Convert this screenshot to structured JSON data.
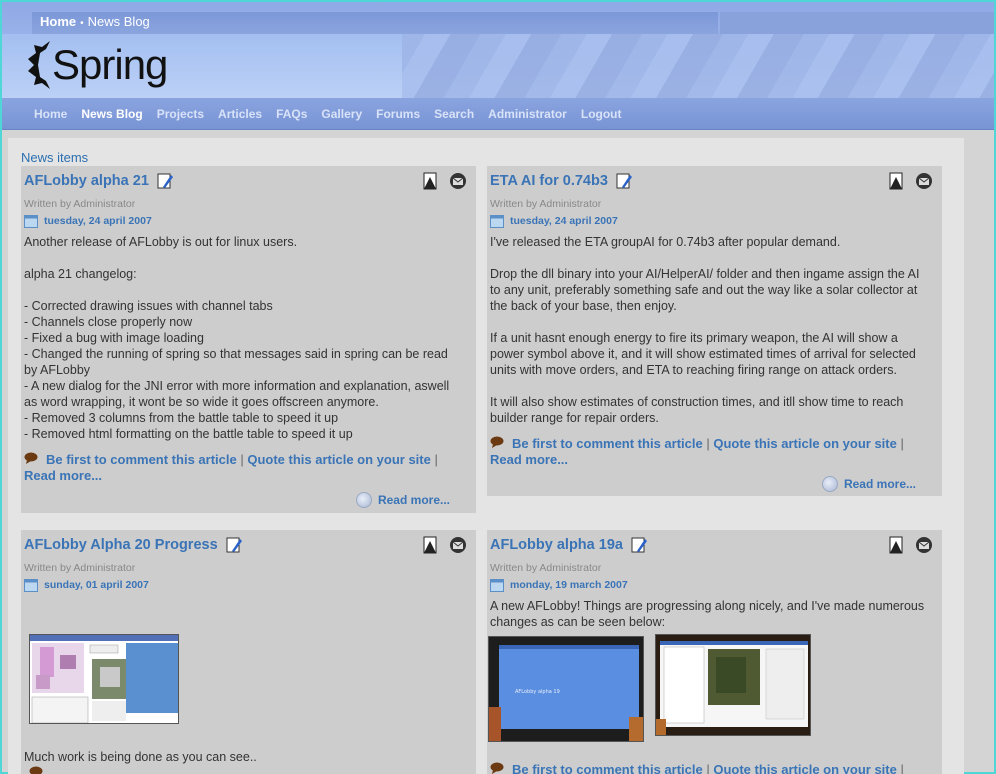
{
  "breadcrumb": {
    "home": "Home",
    "current": "News Blog"
  },
  "logo": {
    "text": "Spring"
  },
  "nav": [
    "Home",
    "News Blog",
    "Projects",
    "Articles",
    "FAQs",
    "Gallery",
    "Forums",
    "Search",
    "Administrator",
    "Logout"
  ],
  "nav_active": "News Blog",
  "section_title": "News items",
  "common": {
    "written_by": "Written by Administrator",
    "comment_link": "Be first to comment this article",
    "quote_link": "Quote this article on your site",
    "read_more": "Read more...",
    "pipe": "|"
  },
  "articles": [
    {
      "title": "AFLobby alpha 21",
      "date": "tuesday, 24 april 2007",
      "body": "Another release of AFLobby is out for linux users.\n\nalpha 21 changelog:\n\n- Corrected drawing issues with channel tabs\n- Channels close properly now\n- Fixed a bug with image loading\n- Changed the running of spring so that messages said in spring can be read\nby AFLobby\n- A new dialog for the JNI error with more information and explanation, aswell\nas word wrapping, it wont be so wide it goes offscreen anymore.\n- Removed 3 columns from the battle table to speed it up\n- Removed html formatting on the battle table to speed it up"
    },
    {
      "title": "ETA AI for 0.74b3",
      "date": "tuesday, 24 april 2007",
      "body": "I've released the ETA groupAI for 0.74b3 after popular demand.\n\nDrop the dll binary into your AI/HelperAI/ folder and then ingame assign the AI\nto any unit, preferably something safe and out the way like a solar collector at\nthe back of your base, then enjoy.\n\nIf a unit hasnt enough energy to fire its primary weapon, the AI will show a\npower symbol above it, and it will show estimated times of arrival for selected\nunits with move orders, and ETA to reaching firing range on attack orders.\n\nIt will also show estimates of construction times, and itll show time to reach\nbuilder range for repair orders."
    },
    {
      "title": "AFLobby Alpha 20 Progress",
      "date": "sunday, 01 april 2007",
      "body": "Much work is being done as you can see.."
    },
    {
      "title": "AFLobby alpha 19a",
      "date": "monday, 19 march 2007",
      "body": "A new AFLobby! Things are progressing along nicely, and I've made numerous\nchanges as can be seen below:"
    }
  ],
  "colors": {
    "accent": "#3a74b6",
    "nav_bg": "#7f99d8",
    "panel": "#cdcdcd"
  }
}
